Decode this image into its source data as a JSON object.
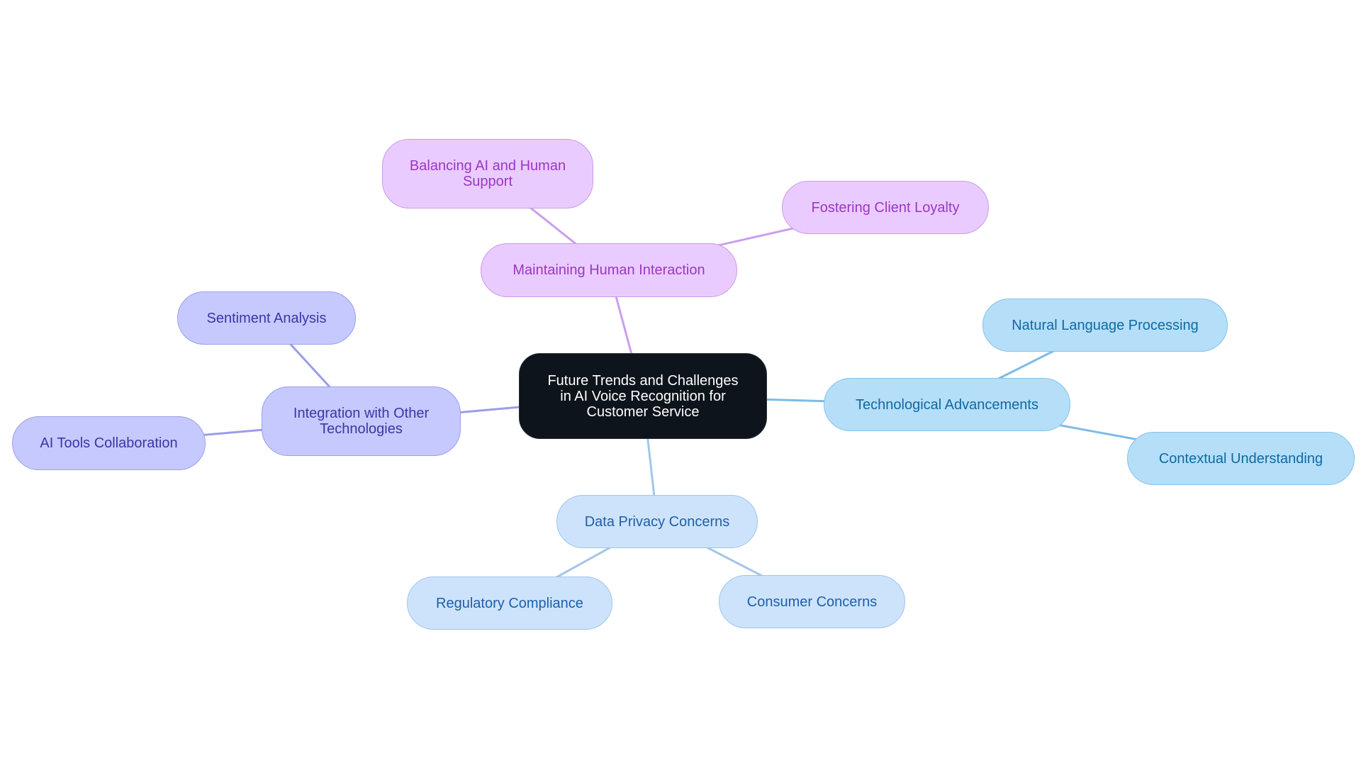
{
  "diagram": {
    "type": "mindmap",
    "root": {
      "id": "root",
      "label": "Future Trends and Challenges\nin AI Voice Recognition for\nCustomer Service",
      "fill": "#0d141b",
      "text": "#ffffff",
      "border": "#2a2f36"
    },
    "branches": [
      {
        "id": "human",
        "label": "Maintaining Human Interaction",
        "theme": "purple",
        "children": [
          {
            "id": "balancing",
            "label": "Balancing AI and Human\nSupport"
          },
          {
            "id": "loyalty",
            "label": "Fostering Client Loyalty"
          }
        ]
      },
      {
        "id": "integration",
        "label": "Integration with Other\nTechnologies",
        "theme": "indigo",
        "children": [
          {
            "id": "sentiment",
            "label": "Sentiment Analysis"
          },
          {
            "id": "aitools",
            "label": "AI Tools Collaboration"
          }
        ]
      },
      {
        "id": "tech",
        "label": "Technological Advancements",
        "theme": "sky",
        "children": [
          {
            "id": "nlp",
            "label": "Natural Language Processing"
          },
          {
            "id": "context",
            "label": "Contextual Understanding"
          }
        ]
      },
      {
        "id": "privacy",
        "label": "Data Privacy Concerns",
        "theme": "lightblue",
        "children": [
          {
            "id": "regulatory",
            "label": "Regulatory Compliance"
          },
          {
            "id": "consumer",
            "label": "Consumer Concerns"
          }
        ]
      }
    ],
    "themes": {
      "purple": {
        "fill": "#eacbff",
        "border": "#c99be6",
        "text": "#9a37c4",
        "edge": "#c9a0ec"
      },
      "indigo": {
        "fill": "#c6c9fd",
        "border": "#9c9fe8",
        "text": "#3a37a6",
        "edge": "#9a9de6"
      },
      "sky": {
        "fill": "#b5def9",
        "border": "#88c2ea",
        "text": "#0f6aa0",
        "edge": "#7dbbe6"
      },
      "lightblue": {
        "fill": "#cde3fb",
        "border": "#9fc5ec",
        "text": "#1f5fa8",
        "edge": "#a3c6ea"
      }
    }
  }
}
